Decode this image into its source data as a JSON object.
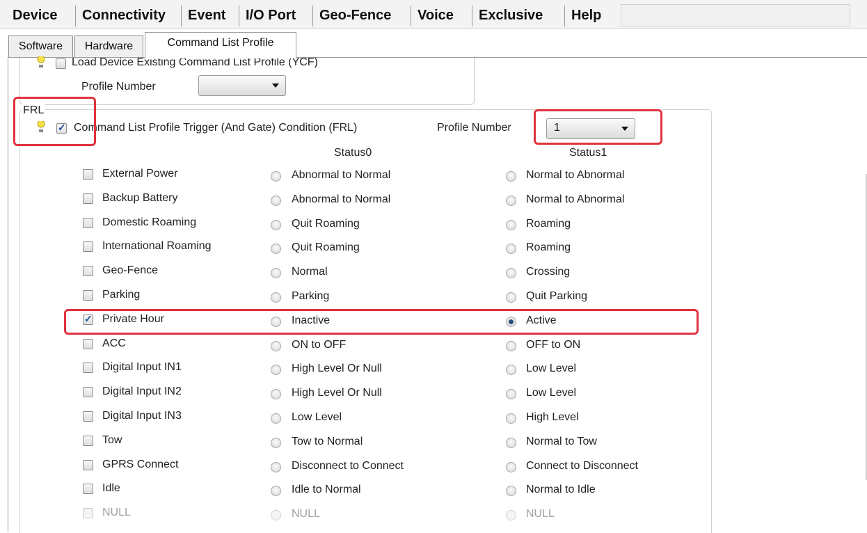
{
  "menu": [
    "Device",
    "Connectivity",
    "Event",
    "I/O Port",
    "Geo-Fence",
    "Voice",
    "Exclusive",
    "Help"
  ],
  "subtabs": [
    "Software",
    "Hardware",
    "Command List Profile"
  ],
  "active_subtab": "Command List Profile",
  "ycf": {
    "checkbox_label": "Load Device Existing Command List Profile (YCF)",
    "checked": false,
    "profile_number_label": "Profile Number",
    "profile_number_value": ""
  },
  "frl": {
    "group_label": "FRL",
    "checkbox_label": "Command List Profile Trigger (And Gate) Condition (FRL)",
    "checked": true,
    "profile_number_label": "Profile Number",
    "profile_number_value": "1",
    "status0_header": "Status0",
    "status1_header": "Status1",
    "rows": [
      {
        "label": "External Power",
        "checked": false,
        "status0": "Abnormal to Normal",
        "status1": "Normal to Abnormal",
        "selected": "none",
        "disabled": false
      },
      {
        "label": "Backup Battery",
        "checked": false,
        "status0": "Abnormal to Normal",
        "status1": "Normal to Abnormal",
        "selected": "none",
        "disabled": false
      },
      {
        "label": "Domestic Roaming",
        "checked": false,
        "status0": "Quit Roaming",
        "status1": "Roaming",
        "selected": "none",
        "disabled": false
      },
      {
        "label": "International Roaming",
        "checked": false,
        "status0": "Quit Roaming",
        "status1": "Roaming",
        "selected": "none",
        "disabled": false
      },
      {
        "label": "Geo-Fence",
        "checked": false,
        "status0": "Normal",
        "status1": "Crossing",
        "selected": "none",
        "disabled": false
      },
      {
        "label": "Parking",
        "checked": false,
        "status0": "Parking",
        "status1": "Quit Parking",
        "selected": "none",
        "disabled": false
      },
      {
        "label": "Private Hour",
        "checked": true,
        "status0": "Inactive",
        "status1": "Active",
        "selected": "status1",
        "disabled": false
      },
      {
        "label": "ACC",
        "checked": false,
        "status0": "ON to OFF",
        "status1": "OFF to ON",
        "selected": "none",
        "disabled": false
      },
      {
        "label": "Digital Input IN1",
        "checked": false,
        "status0": "High Level Or Null",
        "status1": "Low Level",
        "selected": "none",
        "disabled": false
      },
      {
        "label": "Digital Input IN2",
        "checked": false,
        "status0": "High Level Or Null",
        "status1": "Low Level",
        "selected": "none",
        "disabled": false
      },
      {
        "label": "Digital Input IN3",
        "checked": false,
        "status0": "Low Level",
        "status1": "High Level",
        "selected": "none",
        "disabled": false
      },
      {
        "label": "Tow",
        "checked": false,
        "status0": "Tow to Normal",
        "status1": "Normal to Tow",
        "selected": "none",
        "disabled": false
      },
      {
        "label": "GPRS Connect",
        "checked": false,
        "status0": "Disconnect to Connect",
        "status1": "Connect to Disconnect",
        "selected": "none",
        "disabled": false
      },
      {
        "label": "Idle",
        "checked": false,
        "status0": "Idle to Normal",
        "status1": "Normal to Idle",
        "selected": "none",
        "disabled": false
      },
      {
        "label": "NULL",
        "checked": false,
        "status0": "NULL",
        "status1": "NULL",
        "selected": "none",
        "disabled": true
      }
    ]
  },
  "highlight_color": "#e0323f"
}
